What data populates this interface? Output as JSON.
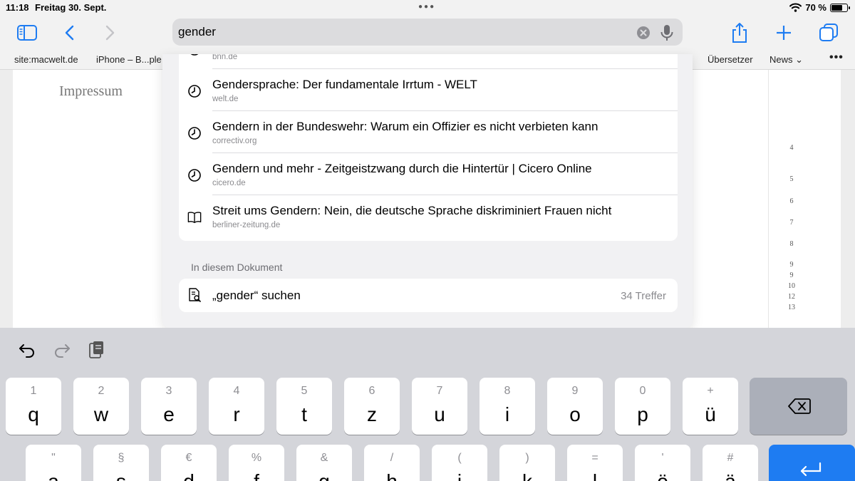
{
  "status_bar": {
    "time": "11:18",
    "date": "Freitag 30. Sept.",
    "battery": "70 %",
    "battery_level": 0.7
  },
  "toolbar": {
    "address_value": "gender"
  },
  "bookmarks": [
    "site:macwelt.de",
    "iPhone – B...ple",
    "Übersetzer",
    "News ⌄"
  ],
  "page": {
    "heading": "Impressum",
    "page_numbers": [
      "4",
      "5",
      "6",
      "7",
      "8",
      "9",
      "9",
      "10",
      "12",
      "13"
    ]
  },
  "suggestions": {
    "partial_url": "bnn.de",
    "items": [
      {
        "title": "Gendersprache: Der fundamentale Irrtum - WELT",
        "url": "welt.de",
        "icon": "history-clock-icon"
      },
      {
        "title": "Gendern in der Bundeswehr: Warum ein Offizier es nicht verbieten kann",
        "url": "correctiv.org",
        "icon": "history-clock-icon"
      },
      {
        "title": "Gendern und mehr - Zeitgeistzwang durch die Hintertür | Cicero Online",
        "url": "cicero.de",
        "icon": "history-clock-icon"
      },
      {
        "title": "Streit ums Gendern: Nein, die deutsche Sprache diskriminiert Frauen nicht",
        "url": "berliner-zeitung.de",
        "icon": "book-icon"
      }
    ],
    "section_label": "In diesem Dokument",
    "find": {
      "text": "„gender“ suchen",
      "count": "34 Treffer"
    }
  },
  "keyboard": {
    "row1": [
      {
        "alt": "1",
        "main": "q"
      },
      {
        "alt": "2",
        "main": "w"
      },
      {
        "alt": "3",
        "main": "e"
      },
      {
        "alt": "4",
        "main": "r"
      },
      {
        "alt": "5",
        "main": "t"
      },
      {
        "alt": "6",
        "main": "z"
      },
      {
        "alt": "7",
        "main": "u"
      },
      {
        "alt": "8",
        "main": "i"
      },
      {
        "alt": "9",
        "main": "o"
      },
      {
        "alt": "0",
        "main": "p"
      },
      {
        "alt": "+",
        "main": "ü"
      }
    ],
    "row2": [
      {
        "alt": "\"",
        "main": "a"
      },
      {
        "alt": "§",
        "main": "s"
      },
      {
        "alt": "€",
        "main": "d"
      },
      {
        "alt": "%",
        "main": "f"
      },
      {
        "alt": "&",
        "main": "g"
      },
      {
        "alt": "/",
        "main": "h"
      },
      {
        "alt": "(",
        "main": "j"
      },
      {
        "alt": ")",
        "main": "k"
      },
      {
        "alt": "=",
        "main": "l"
      },
      {
        "alt": "'",
        "main": "ö"
      },
      {
        "alt": "#",
        "main": "ä"
      }
    ]
  },
  "colors": {
    "accent": "#1e7cf2",
    "keyboard_bg": "#d4d5da",
    "return_key": "#1e7cf2"
  }
}
